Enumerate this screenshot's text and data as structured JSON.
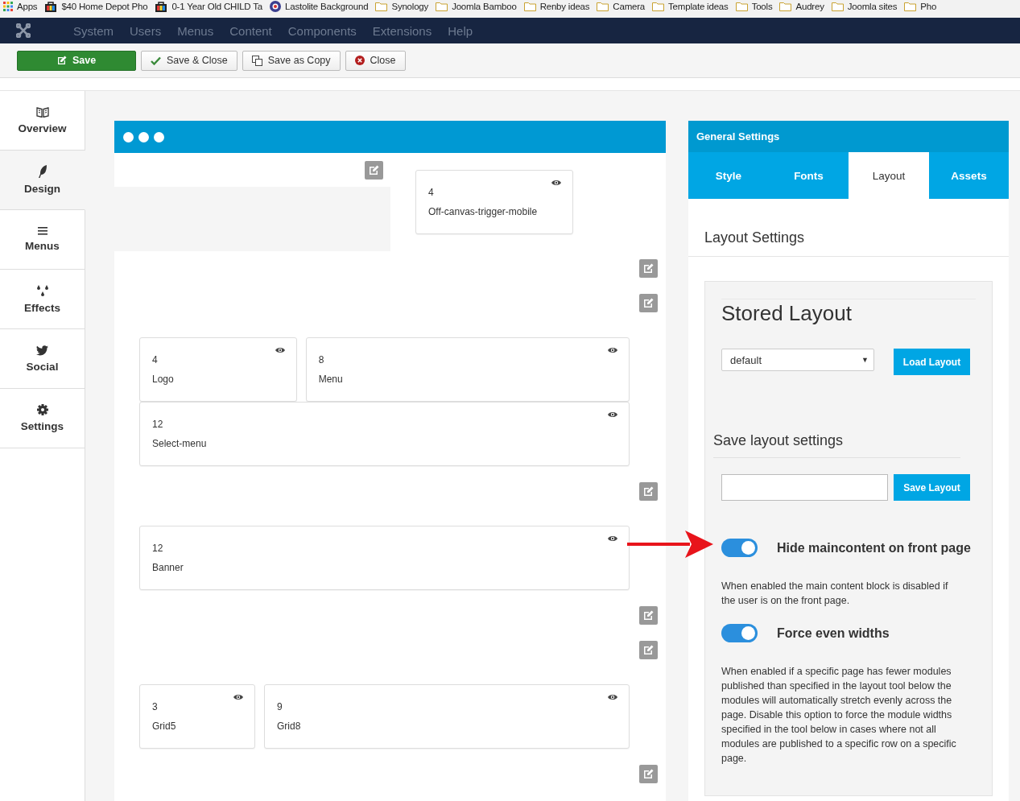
{
  "bookmarks": [
    {
      "kind": "apps",
      "label": "Apps"
    },
    {
      "kind": "bag",
      "label": "$40 Home Depot Pho"
    },
    {
      "kind": "bag",
      "label": "0-1 Year Old CHILD Ta"
    },
    {
      "kind": "disc",
      "label": "Lastolite Background"
    },
    {
      "kind": "folder",
      "label": "Synology"
    },
    {
      "kind": "folder",
      "label": "Joomla Bamboo"
    },
    {
      "kind": "folder",
      "label": "Renby ideas"
    },
    {
      "kind": "folder",
      "label": "Camera"
    },
    {
      "kind": "folder",
      "label": "Template ideas"
    },
    {
      "kind": "folder",
      "label": "Tools"
    },
    {
      "kind": "folder",
      "label": "Audrey"
    },
    {
      "kind": "folder",
      "label": "Joomla sites"
    },
    {
      "kind": "folder",
      "label": "Pho"
    }
  ],
  "menu": [
    "System",
    "Users",
    "Menus",
    "Content",
    "Components",
    "Extensions",
    "Help"
  ],
  "toolbar": [
    {
      "kind": "save",
      "label": "Save"
    },
    {
      "kind": "check",
      "label": "Save & Close"
    },
    {
      "kind": "copy",
      "label": "Save as Copy"
    },
    {
      "kind": "close",
      "label": "Close"
    }
  ],
  "sidebar": [
    {
      "kind": "book",
      "label": "Overview",
      "selected": false
    },
    {
      "kind": "feather",
      "label": "Design",
      "selected": true
    },
    {
      "kind": "bars",
      "label": "Menus",
      "selected": false
    },
    {
      "kind": "drops",
      "label": "Effects",
      "selected": false
    },
    {
      "kind": "bird",
      "label": "Social",
      "selected": false
    },
    {
      "kind": "gear",
      "label": "Settings",
      "selected": false
    }
  ],
  "canvas": {
    "blocks": [
      {
        "kind": "header",
        "modules": [
          {
            "size": "4",
            "name": "Off-canvas-trigger-mobile"
          }
        ]
      },
      {
        "kind": "edit"
      },
      {
        "kind": "edit"
      },
      {
        "kind": "row",
        "modules": [
          {
            "size": "4",
            "name": "Logo"
          },
          {
            "size": "8",
            "name": "Menu"
          }
        ]
      },
      {
        "kind": "row",
        "modules": [
          {
            "size": "12",
            "name": "Select-menu"
          }
        ]
      },
      {
        "kind": "edit"
      },
      {
        "kind": "row",
        "modules": [
          {
            "size": "12",
            "name": "Banner"
          }
        ]
      },
      {
        "kind": "edit"
      },
      {
        "kind": "edit"
      },
      {
        "kind": "row",
        "modules": [
          {
            "size": "3",
            "name": "Grid5"
          },
          {
            "size": "9",
            "name": "Grid8"
          }
        ]
      },
      {
        "kind": "edit"
      }
    ]
  },
  "settings": {
    "title": "General Settings",
    "tabs": [
      {
        "label": "Style",
        "selected": false
      },
      {
        "label": "Fonts",
        "selected": false
      },
      {
        "label": "Layout",
        "selected": true
      },
      {
        "label": "Assets",
        "selected": false
      }
    ],
    "heading": "Layout Settings",
    "stored": {
      "title": "Stored Layout",
      "select_value": "default",
      "caret": "▼",
      "button": "Load Layout"
    },
    "save": {
      "title": "Save layout settings",
      "button": "Save Layout"
    },
    "toggles": [
      {
        "label": "Hide maincontent on front page",
        "on": true,
        "description": "When enabled the main content block is disabled if the user is on the front page."
      },
      {
        "label": "Force even widths",
        "on": true,
        "description": "When enabled if a specific page has fewer modules published than specified in the layout tool below the modules will automatically stretch evenly across the page. Disable this option to force the module widths specified in the tool below in cases where not all modules are published to a specific row on a specific page."
      }
    ]
  }
}
